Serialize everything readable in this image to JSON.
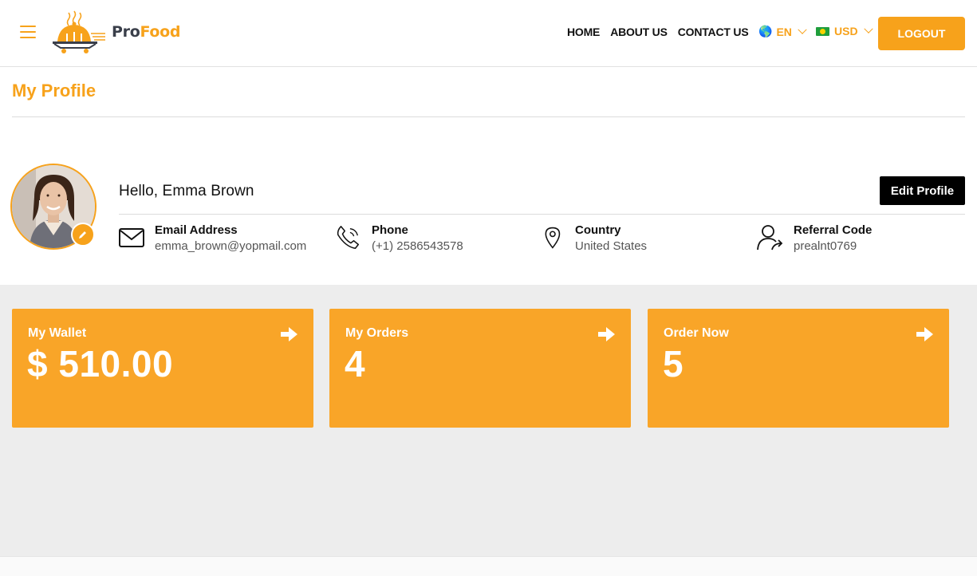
{
  "brand": {
    "name_part1": "Pro",
    "name_part2": "Food"
  },
  "nav": {
    "items": [
      {
        "label": "HOME"
      },
      {
        "label": "ABOUT US"
      },
      {
        "label": "CONTACT US"
      }
    ],
    "language": {
      "flag": "🌎",
      "value": "EN"
    },
    "currency": {
      "value": "USD"
    },
    "logout_label": "LOGOUT"
  },
  "page": {
    "title": "My Profile"
  },
  "profile": {
    "greeting": "Hello, Emma Brown",
    "edit_label": "Edit Profile",
    "fields": [
      {
        "label": "Email Address",
        "value": "emma_brown@yopmail.com",
        "icon": "envelope-icon"
      },
      {
        "label": "Phone",
        "value": "(+1) 2586543578",
        "icon": "phone-icon"
      },
      {
        "label": "Country",
        "value": "United States",
        "icon": "location-pin-icon"
      },
      {
        "label": "Referral Code",
        "value": "prealnt0769",
        "icon": "user-referral-icon"
      }
    ]
  },
  "cards": [
    {
      "title": "My Wallet",
      "value": "$ 510.00"
    },
    {
      "title": "My Orders",
      "value": "4"
    },
    {
      "title": "Order Now",
      "value": "5"
    }
  ],
  "colors": {
    "accent": "#f7a21b",
    "card": "#f9a528",
    "background": "#ededed"
  }
}
